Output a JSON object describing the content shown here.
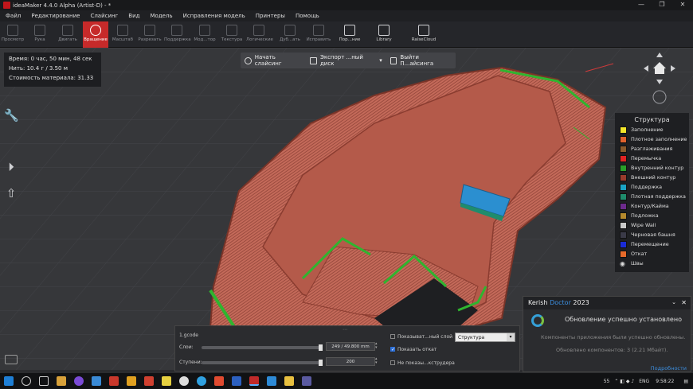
{
  "window": {
    "title": "ideaMaker 4.4.0 Alpha (Artist-D) - *",
    "min": "—",
    "max": "❐",
    "close": "✕"
  },
  "menu": [
    "Файл",
    "Редактирование",
    "Слайсинг",
    "Вид",
    "Модель",
    "Исправления модель",
    "Принтеры",
    "Помощь"
  ],
  "toolbar": [
    "Просмотр",
    "Рука",
    "Двигать",
    "Вращение",
    "Масштаб",
    "Разрезать",
    "Поддержка",
    "Мод...тор",
    "Текстура",
    "Логические",
    "Дуб...ать",
    "Исправить",
    "Пор...ние",
    "Library",
    "RaiseCloud"
  ],
  "info": {
    "time": "Время: 0 час, 50 мин, 48 сек",
    "filament": "Нить: 10.4 г / 3.50 м",
    "cost": "Стоимость материала: 31.33"
  },
  "actions": {
    "slice": "Начать слайсинг",
    "export": "Экспорт ...ный диск",
    "exit": "Выйти П...айсинга"
  },
  "legend": {
    "title": "Структура",
    "items": [
      {
        "label": "Заполнение",
        "color": "#f2e52a"
      },
      {
        "label": "Плотное заполнение",
        "color": "#e0612d"
      },
      {
        "label": "Разглаживания",
        "color": "#8a5a2c"
      },
      {
        "label": "Перемычка",
        "color": "#e22323"
      },
      {
        "label": "Внутренний контур",
        "color": "#2a9f2a"
      },
      {
        "label": "Внешний контур",
        "color": "#9a3b2c"
      },
      {
        "label": "Поддержка",
        "color": "#1ba3c4"
      },
      {
        "label": "Плотная поддержка",
        "color": "#1f8c6c"
      },
      {
        "label": "Контур/Кайма",
        "color": "#6d2a8c"
      },
      {
        "label": "Подложка",
        "color": "#b68a2d"
      },
      {
        "label": "Wipe Wall",
        "color": "#c9c9c9"
      },
      {
        "label": "Черновая башня",
        "color": "#3a3a48"
      },
      {
        "label": "Перемещение",
        "color": "#1a2bd6"
      },
      {
        "label": "Откат",
        "color": "#e66a2a"
      },
      {
        "label": "Швы",
        "color": "#dddddd"
      }
    ]
  },
  "panel": {
    "file": "1.gcode",
    "layers_label": "Слои:",
    "layers_value": "249 / 49.800 mm",
    "steps_label": "Ступени:",
    "steps_value": "200",
    "show_layer": "Показыват...ный слой",
    "show_retract": "Показать откат",
    "hide_extruder": "Не показы...кструдера",
    "structure": "Структура",
    "show_layer_checked": false,
    "show_retract_checked": true,
    "hide_extruder_checked": false
  },
  "toast": {
    "brand": "Kerish",
    "brand2": "Doctor",
    "year": "2023",
    "title": "Обновление успешно установлено",
    "line1": "Компоненты приложения были успешно обновлены.",
    "line2": "Обновлено компонентов: 3 (2.21 Мбайт).",
    "link": "Подробности"
  },
  "taskbar": {
    "lang": "ENG",
    "time": "9:58:22",
    "weather": "55"
  }
}
